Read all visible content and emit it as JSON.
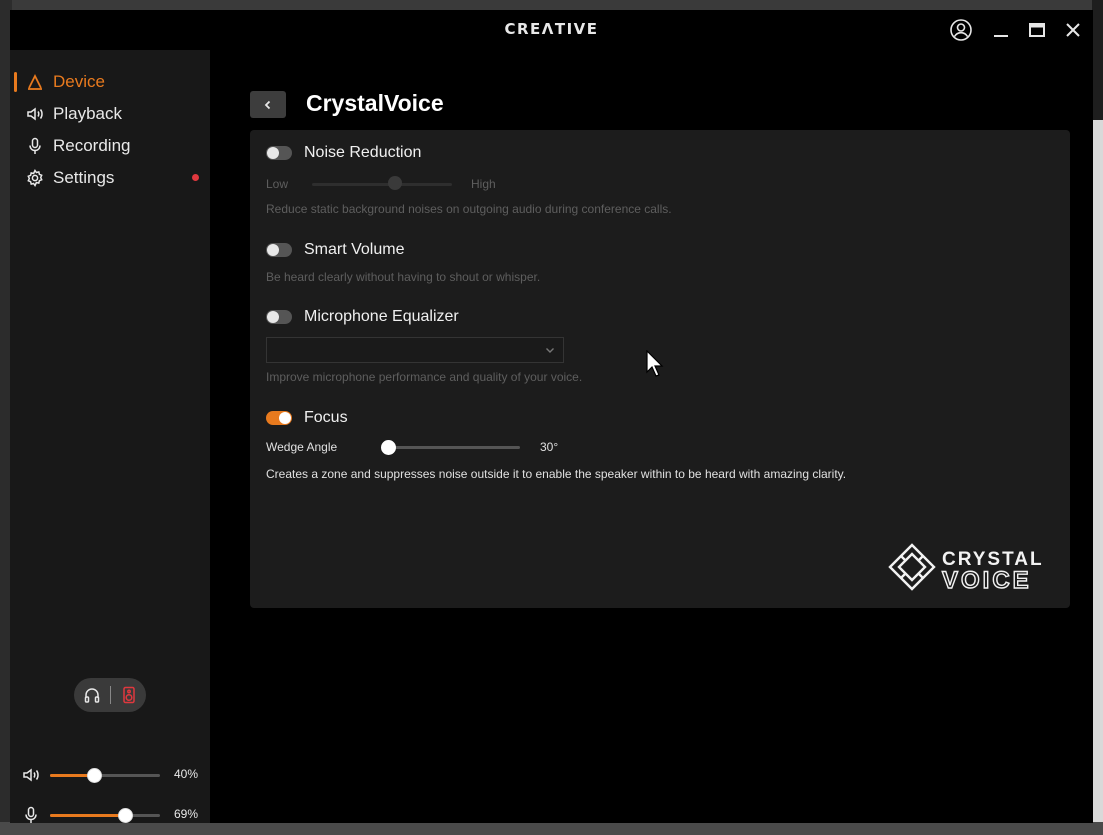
{
  "app": {
    "brand": "CREΛTIVE"
  },
  "window_controls": {
    "account_icon": "user-circle-icon",
    "minimize_icon": "minimize-icon",
    "maximize_icon": "maximize-icon",
    "close_icon": "close-icon"
  },
  "sidebar": {
    "items": [
      {
        "label": "Device",
        "icon": "device-icon",
        "active": true
      },
      {
        "label": "Playback",
        "icon": "speaker-icon"
      },
      {
        "label": "Recording",
        "icon": "microphone-icon"
      },
      {
        "label": "Settings",
        "icon": "gear-icon",
        "notification": true
      }
    ],
    "output_toggle": {
      "left_icon": "headphones-icon",
      "right_icon": "speaker-box-icon",
      "selected": "speaker"
    },
    "volume": {
      "icon": "speaker-icon",
      "value": 0.4,
      "label": "40%"
    },
    "mic": {
      "icon": "microphone-icon",
      "value": 0.69,
      "label": "69%"
    }
  },
  "page": {
    "title": "CrystalVoice",
    "back_icon": "chevron-left-icon",
    "noise_reduction": {
      "title": "Noise Reduction",
      "enabled": false,
      "low_label": "Low",
      "high_label": "High",
      "level": 0.6,
      "description": "Reduce static background noises on outgoing audio during conference calls."
    },
    "smart_volume": {
      "title": "Smart Volume",
      "enabled": false,
      "description": "Be heard clearly without having to shout or whisper."
    },
    "mic_equalizer": {
      "title": "Microphone Equalizer",
      "enabled": false,
      "selected": "",
      "description": "Improve microphone performance and quality of your voice."
    },
    "focus": {
      "title": "Focus",
      "enabled": true,
      "wedge_label": "Wedge Angle",
      "wedge_value": "30°",
      "wedge_fraction": 0.0,
      "description": "Creates a zone and suppresses noise outside it to enable the speaker within to be heard with amazing clarity."
    },
    "logo": {
      "line1": "CRYSTAL",
      "line2": "VOICE"
    }
  },
  "colors": {
    "accent": "#e87a1e",
    "notification": "#e0383e",
    "panel": "#1c1c1c",
    "sidebar": "#181818"
  }
}
